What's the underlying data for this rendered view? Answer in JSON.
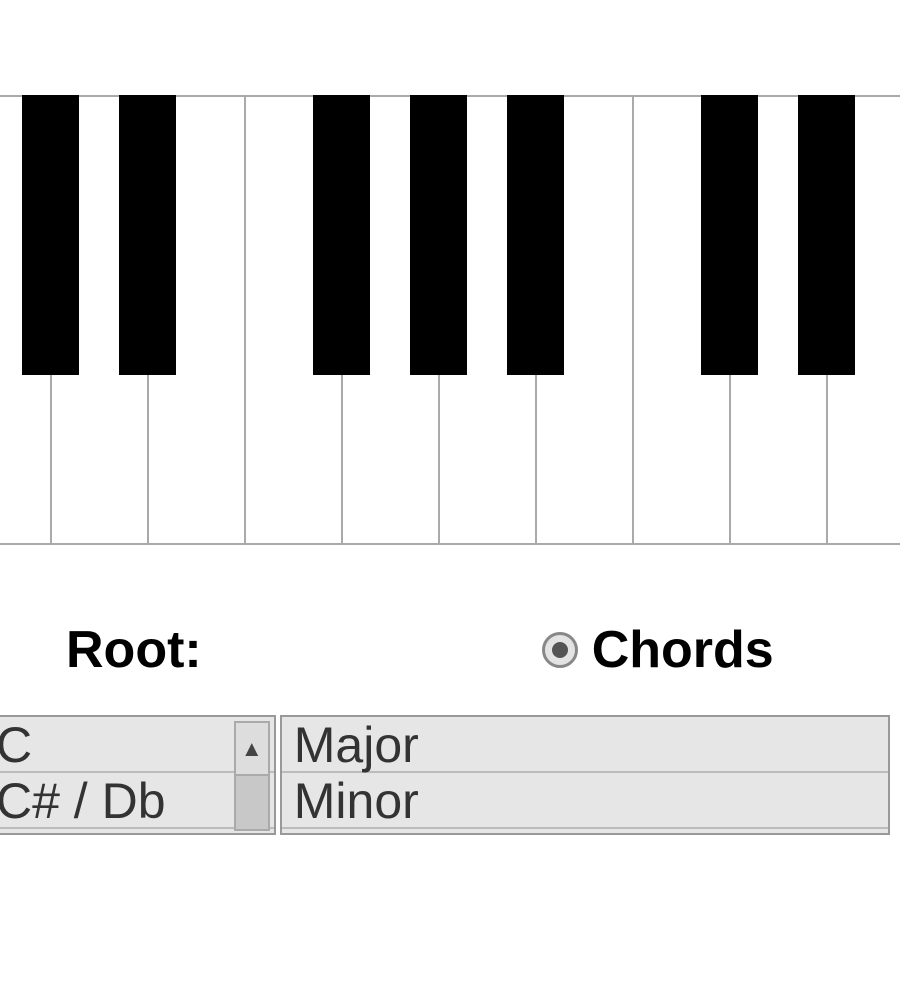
{
  "labels": {
    "root": "Root:",
    "chords": "Chords"
  },
  "root_list": [
    "C",
    "C# / Db"
  ],
  "chord_list": [
    "Major",
    "Minor"
  ],
  "mode_selected": "chords"
}
